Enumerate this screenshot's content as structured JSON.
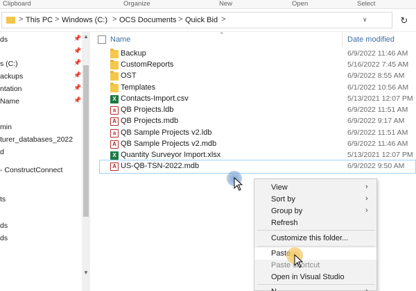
{
  "ribbon": {
    "groups": [
      "Clipboard",
      "Organize",
      "New",
      "Open",
      "Select"
    ]
  },
  "address_bar": {
    "crumbs": [
      "This PC",
      "Windows (C:)",
      "OCS Documents",
      "Quick Bid"
    ],
    "separator": ">",
    "dropdown_icon": "chevron-down-icon",
    "refresh_icon": "refresh-icon"
  },
  "nav_pane": {
    "items": [
      {
        "label": "ds",
        "pinned": true
      },
      {
        "label": "",
        "pinned": true
      },
      {
        "label": "s (C:)",
        "pinned": true
      },
      {
        "label": "ackups",
        "pinned": true
      },
      {
        "label": "ntation",
        "pinned": true
      },
      {
        "label": "Name",
        "pinned": true
      },
      {
        "label": "min",
        "pinned": false
      },
      {
        "label": "turer_databases_2022",
        "pinned": false
      },
      {
        "label": "d",
        "pinned": false
      },
      {
        "label": "- ConstructConnect",
        "pinned": false
      },
      {
        "label": "ts",
        "pinned": false
      },
      {
        "label": "ds",
        "pinned": false
      },
      {
        "label": "ds",
        "pinned": false
      }
    ]
  },
  "file_list": {
    "columns": {
      "name": "Name",
      "date": "Date modified"
    },
    "rows": [
      {
        "name": "Backup",
        "date": "6/9/2022 11:46 AM",
        "type": "folder"
      },
      {
        "name": "CustomReports",
        "date": "5/16/2022 7:45 AM",
        "type": "folder"
      },
      {
        "name": "OST",
        "date": "6/9/2022 8:55 AM",
        "type": "folder"
      },
      {
        "name": "Templates",
        "date": "6/1/2022 10:56 AM",
        "type": "folder"
      },
      {
        "name": "Contacts-Import.csv",
        "date": "5/13/2021 12:07 PM",
        "type": "excel"
      },
      {
        "name": "QB Projects.ldb",
        "date": "6/9/2022 11:51 AM",
        "type": "lock"
      },
      {
        "name": "QB Projects.mdb",
        "date": "6/9/2022 9:17 AM",
        "type": "access"
      },
      {
        "name": "QB Sample Projects v2.ldb",
        "date": "6/9/2022 11:51 AM",
        "type": "lock"
      },
      {
        "name": "QB Sample Projects v2.mdb",
        "date": "6/9/2022 11:46 AM",
        "type": "access"
      },
      {
        "name": "Quantity Surveyor Import.xlsx",
        "date": "5/13/2021 12:07 PM",
        "type": "excel"
      },
      {
        "name": "US-QB-TSN-2022.mdb",
        "date": "6/9/2022 9:50 AM",
        "type": "access",
        "selected": true
      }
    ]
  },
  "context_menu": {
    "items": [
      {
        "label": "View",
        "submenu": true
      },
      {
        "label": "Sort by",
        "submenu": true
      },
      {
        "label": "Group by",
        "submenu": true
      },
      {
        "label": "Refresh",
        "submenu": false
      },
      {
        "label": "Customize this folder...",
        "submenu": false
      },
      {
        "label": "Paste",
        "submenu": false
      },
      {
        "label": "Paste shortcut",
        "submenu": false,
        "disabled": true
      },
      {
        "label": "Open in Visual Studio",
        "submenu": false
      },
      {
        "label": "N",
        "submenu": true
      }
    ]
  },
  "colors": {
    "accent_link": "#3b6ea5",
    "selection_border": "#99d1ff",
    "folder": "#f5c84c",
    "excel": "#1d7a43",
    "access": "#b22d2d",
    "cursor_halo_blue": "#7fa6d6",
    "cursor_halo_yellow": "#f2c45a"
  }
}
